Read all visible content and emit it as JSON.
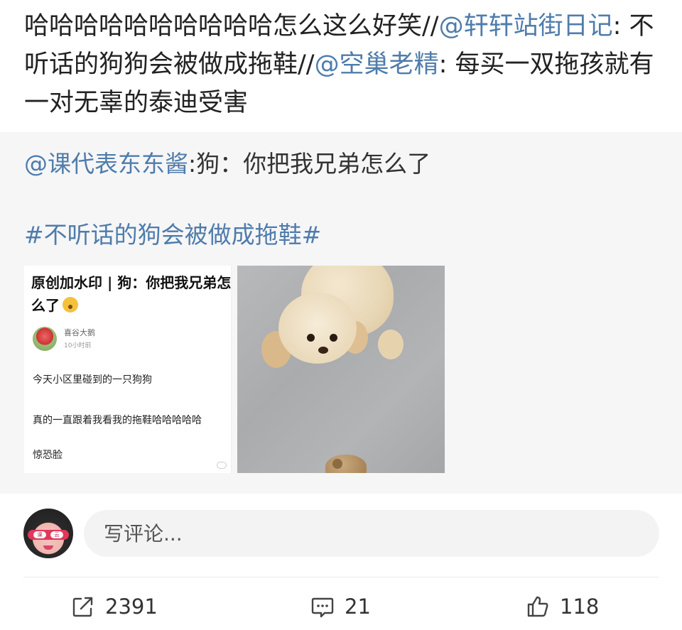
{
  "post": {
    "text_plain_1": "哈哈哈哈哈哈哈哈哈哈怎么这么好笑//",
    "mention_1": "@轩轩站街日记",
    "text_plain_2": ": 不听话的狗狗会被做成拖鞋//",
    "mention_2": "@空巢老精",
    "text_plain_3": ": 每买一双拖孩就有一对无辜的泰迪受害"
  },
  "repost": {
    "mention": "@课代表东东酱",
    "text": ":狗：你把我兄弟怎么了",
    "hashtag": "#不听话的狗会被做成拖鞋#"
  },
  "thumbnail_1": {
    "title": "原创加水印 | 狗：你把我兄弟怎么了",
    "author": "喜谷大鹅",
    "time": "10小时前",
    "line_1": "今天小区里碰到的一只狗狗",
    "line_2": "真的一直跟着我看我的拖鞋哈哈哈哈哈",
    "line_3": "惊恐脸"
  },
  "comment": {
    "avatar_glasses_left": "课",
    "avatar_glasses_right": "云",
    "placeholder": "写评论..."
  },
  "actions": {
    "repost_count": "2391",
    "comment_count": "21",
    "like_count": "118"
  },
  "colors": {
    "mention": "#4f7cab",
    "repost_bg": "#f6f6f7",
    "input_bg": "#f3f3f3"
  }
}
